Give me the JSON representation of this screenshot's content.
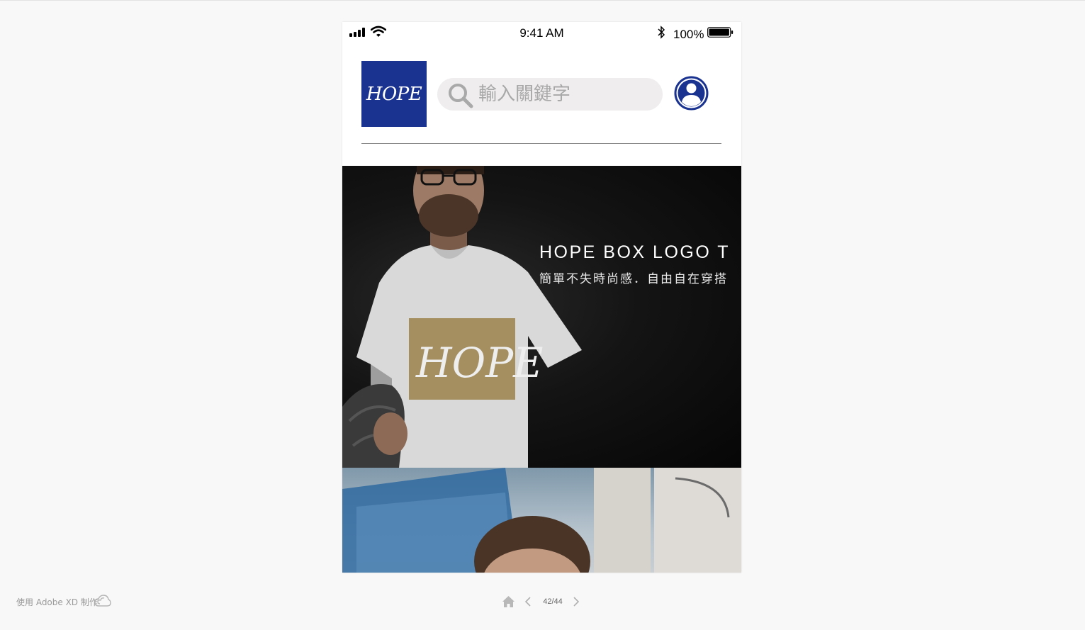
{
  "status_bar": {
    "time": "9:41 AM",
    "battery_percent": "100%",
    "icons": [
      "signal-icon",
      "wifi-icon",
      "bluetooth-icon",
      "battery-icon"
    ]
  },
  "header": {
    "logo_text": "HOPE",
    "logo_color": "#1a3391",
    "search_placeholder": "輸入關鍵字",
    "search_icon": "search-icon",
    "profile_icon": "user-icon",
    "accent_color": "#1a3391"
  },
  "hero": {
    "title": "HOPE BOX LOGO T",
    "subtitle": "簡單不失時尚感．自由自在穿搭",
    "shirt_print": "HOPE"
  },
  "footer": {
    "made_with": "使用 Adobe XD 制作",
    "page_counter": "42/44",
    "icons": [
      "creative-cloud-icon",
      "home-icon",
      "chevron-left-icon",
      "chevron-right-icon"
    ]
  }
}
